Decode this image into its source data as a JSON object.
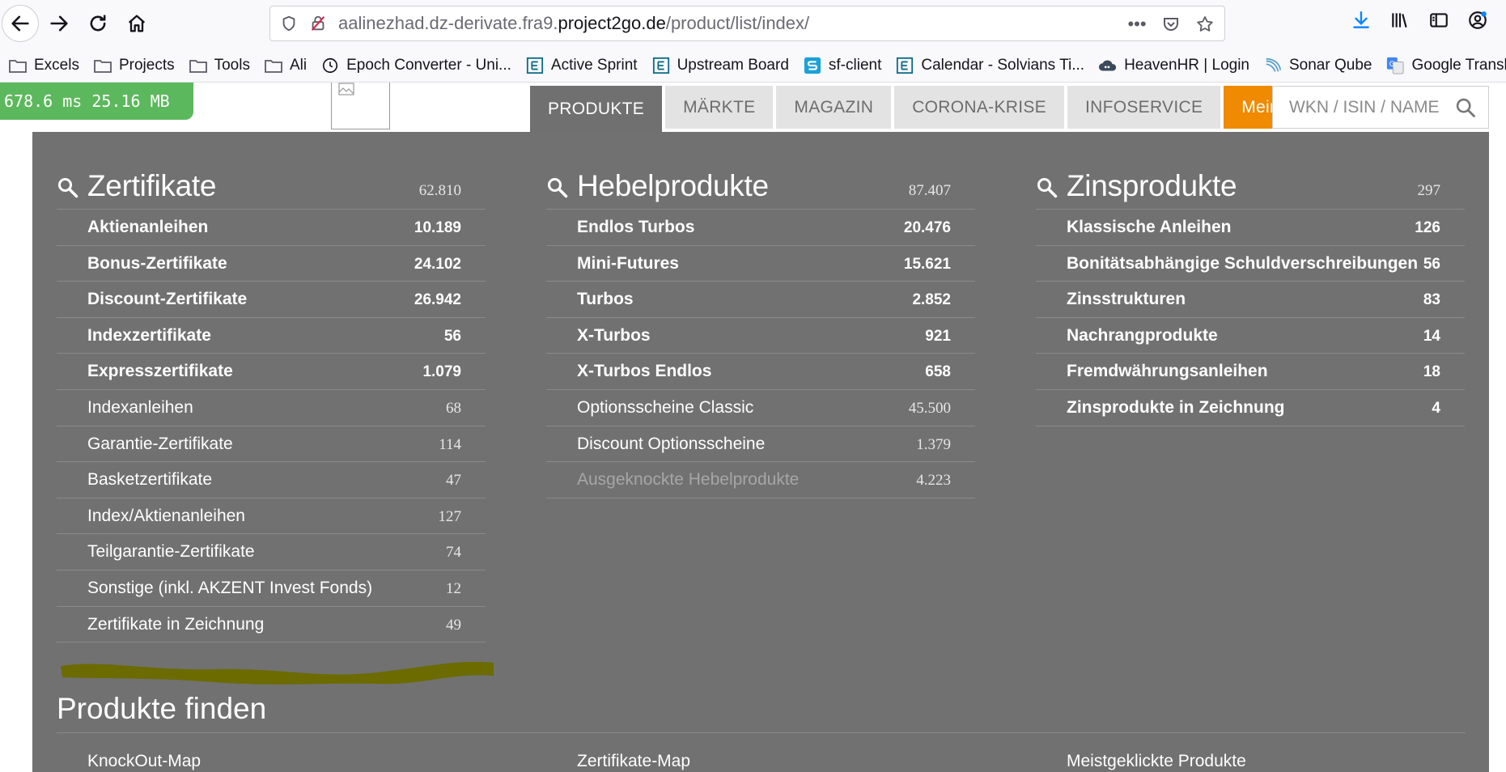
{
  "browser": {
    "url_prefix": "aalinezhad.dz-derivate.fra9.",
    "url_host": "project2go.de",
    "url_path": "/product/list/index/",
    "menu_dots": "•••"
  },
  "bookmarks": [
    {
      "label": "Excels",
      "icon": "folder-icon"
    },
    {
      "label": "Projects",
      "icon": "folder-icon"
    },
    {
      "label": "Tools",
      "icon": "folder-icon"
    },
    {
      "label": "Ali",
      "icon": "folder-icon"
    },
    {
      "label": "Epoch Converter - Uni...",
      "icon": "clock-icon"
    },
    {
      "label": "Active Sprint",
      "icon": "e-icon"
    },
    {
      "label": "Upstream Board",
      "icon": "e-icon"
    },
    {
      "label": "sf-client",
      "icon": "s-icon"
    },
    {
      "label": "Calendar - Solvians Ti...",
      "icon": "e-icon"
    },
    {
      "label": "HeavenHR | Login",
      "icon": "cloud-icon"
    },
    {
      "label": "Sonar Qube",
      "icon": "wave-icon"
    },
    {
      "label": "Google Translate",
      "icon": "translate-icon"
    }
  ],
  "perf": "678.6 ms 25.16 MB",
  "nav": {
    "tabs": [
      "PRODUKTE",
      "MÄRKTE",
      "MAGAZIN",
      "CORONA-KRISE",
      "INFOSERVICE"
    ],
    "portfolio": "MeinPortfolio",
    "search_placeholder": "WKN / ISIN / NAME"
  },
  "columns": [
    {
      "title": "Zertifikate",
      "count": "62.810",
      "items": [
        {
          "label": "Aktienanleihen",
          "count": "10.189",
          "style": "bold"
        },
        {
          "label": "Bonus-Zertifikate",
          "count": "24.102",
          "style": "bold"
        },
        {
          "label": "Discount-Zertifikate",
          "count": "26.942",
          "style": "bold"
        },
        {
          "label": "Indexzertifikate",
          "count": "56",
          "style": "bold"
        },
        {
          "label": "Expresszertifikate",
          "count": "1.079",
          "style": "bold"
        },
        {
          "label": "Indexanleihen",
          "count": "68",
          "style": "normal"
        },
        {
          "label": "Garantie-Zertifikate",
          "count": "114",
          "style": "normal"
        },
        {
          "label": "Basketzertifikate",
          "count": "47",
          "style": "normal"
        },
        {
          "label": "Index/Aktienanleihen",
          "count": "127",
          "style": "normal"
        },
        {
          "label": "Teilgarantie-Zertifikate",
          "count": "74",
          "style": "normal"
        },
        {
          "label": "Sonstige (inkl. AKZENT Invest Fonds)",
          "count": "12",
          "style": "normal"
        },
        {
          "label": "Zertifikate in Zeichnung",
          "count": "49",
          "style": "normal"
        }
      ]
    },
    {
      "title": "Hebelprodukte",
      "count": "87.407",
      "items": [
        {
          "label": "Endlos Turbos",
          "count": "20.476",
          "style": "bold"
        },
        {
          "label": "Mini-Futures",
          "count": "15.621",
          "style": "bold"
        },
        {
          "label": "Turbos",
          "count": "2.852",
          "style": "bold"
        },
        {
          "label": "X-Turbos",
          "count": "921",
          "style": "bold"
        },
        {
          "label": "X-Turbos Endlos",
          "count": "658",
          "style": "bold"
        },
        {
          "label": "Optionsscheine Classic",
          "count": "45.500",
          "style": "normal"
        },
        {
          "label": "Discount Optionsscheine",
          "count": "1.379",
          "style": "normal"
        },
        {
          "label": "Ausgeknockte Hebelprodukte",
          "count": "4.223",
          "style": "dim"
        }
      ]
    },
    {
      "title": "Zinsprodukte",
      "count": "297",
      "items": [
        {
          "label": "Klassische Anleihen",
          "count": "126",
          "style": "bold"
        },
        {
          "label": "Bonitätsabhängige Schuldverschreibungen",
          "count": "56",
          "style": "bold"
        },
        {
          "label": "Zinsstrukturen",
          "count": "83",
          "style": "bold"
        },
        {
          "label": "Nachrangprodukte",
          "count": "14",
          "style": "bold"
        },
        {
          "label": "Fremdwährungsanleihen",
          "count": "18",
          "style": "bold"
        },
        {
          "label": "Zinsprodukte in Zeichnung",
          "count": "4",
          "style": "bold"
        }
      ]
    }
  ],
  "find": {
    "title": "Produkte finden",
    "links": [
      "KnockOut-Map",
      "Zertifikate-Map",
      "Meistgeklickte Produkte"
    ]
  },
  "colors": {
    "panel": "#717171",
    "active_tab": "#707070",
    "portfolio": "#f08a00",
    "perf": "#5cb85c",
    "scribble": "#6b6b00"
  }
}
